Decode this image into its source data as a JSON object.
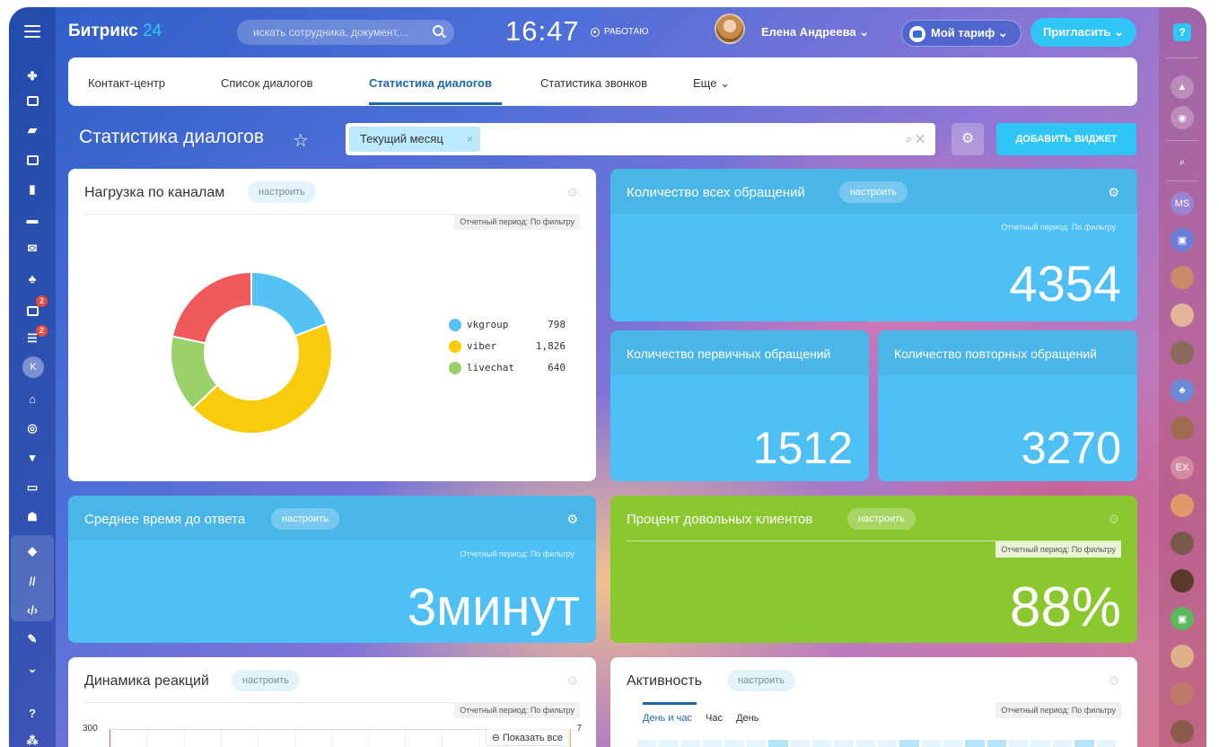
{
  "header": {
    "logo_text": "Битрикс",
    "logo_num": "24",
    "search_placeholder": "искать сотрудника, документ,...",
    "clock": "16:47",
    "work_status": "РАБОТАЮ",
    "user_name": "Елена Андреева",
    "tariff_label": "Мой тариф",
    "invite_label": "Пригласить"
  },
  "left_badges": [
    "2",
    "2"
  ],
  "left_avatar_letter": "K",
  "tabs": [
    {
      "label": "Контакт-центр"
    },
    {
      "label": "Список диалогов"
    },
    {
      "label": "Статистика диалогов"
    },
    {
      "label": "Статистика звонков"
    },
    {
      "label": "Еще"
    }
  ],
  "active_tab": "Статистика диалогов",
  "page_title": "Статистика диалогов",
  "filter": {
    "chip": "Текущий месяц"
  },
  "add_widget_label": "ДОБАВИТЬ ВИДЖЕТ",
  "configure_label": "настроить",
  "period_label": "Отчетный период: По фильтру",
  "widgets": {
    "channels": {
      "title": "Нагрузка по каналам",
      "legend": [
        {
          "name": "vkgroup",
          "value": "798",
          "color": "#55c2f4"
        },
        {
          "name": "viber",
          "value": "1,826",
          "color": "#f8cc0c"
        },
        {
          "name": "livechat",
          "value": "640",
          "color": "#9bd16a"
        }
      ],
      "extra_color": "#f05a5a"
    },
    "all_requests": {
      "title": "Количество всех обращений",
      "value": "4354"
    },
    "primary": {
      "title": "Количество первичных обращений",
      "value": "1512"
    },
    "repeat": {
      "title": "Количество повторных обращений",
      "value": "3270"
    },
    "response_time": {
      "title": "Среднее время до ответа",
      "value": "3минут"
    },
    "satisfied": {
      "title": "Процент довольных клиентов",
      "value": "88%"
    },
    "dynamics": {
      "title": "Динамика реакций",
      "y_left": "300",
      "y_right": "7",
      "zoom_label": "Показать все"
    },
    "activity": {
      "title": "Активность",
      "tabs": [
        "День и час",
        "Час",
        "День"
      ]
    }
  },
  "right_bar": {
    "initials_1": "MS",
    "initials_2": "EX"
  },
  "chart_data": {
    "type": "pie",
    "categories": [
      "vkgroup",
      "viber",
      "livechat",
      ""
    ],
    "values": [
      798,
      1826,
      640,
      905
    ],
    "colors": [
      "#55c2f4",
      "#f8cc0c",
      "#9bd16a",
      "#f05a5a"
    ],
    "donut": true,
    "title": "Нагрузка по каналам"
  }
}
